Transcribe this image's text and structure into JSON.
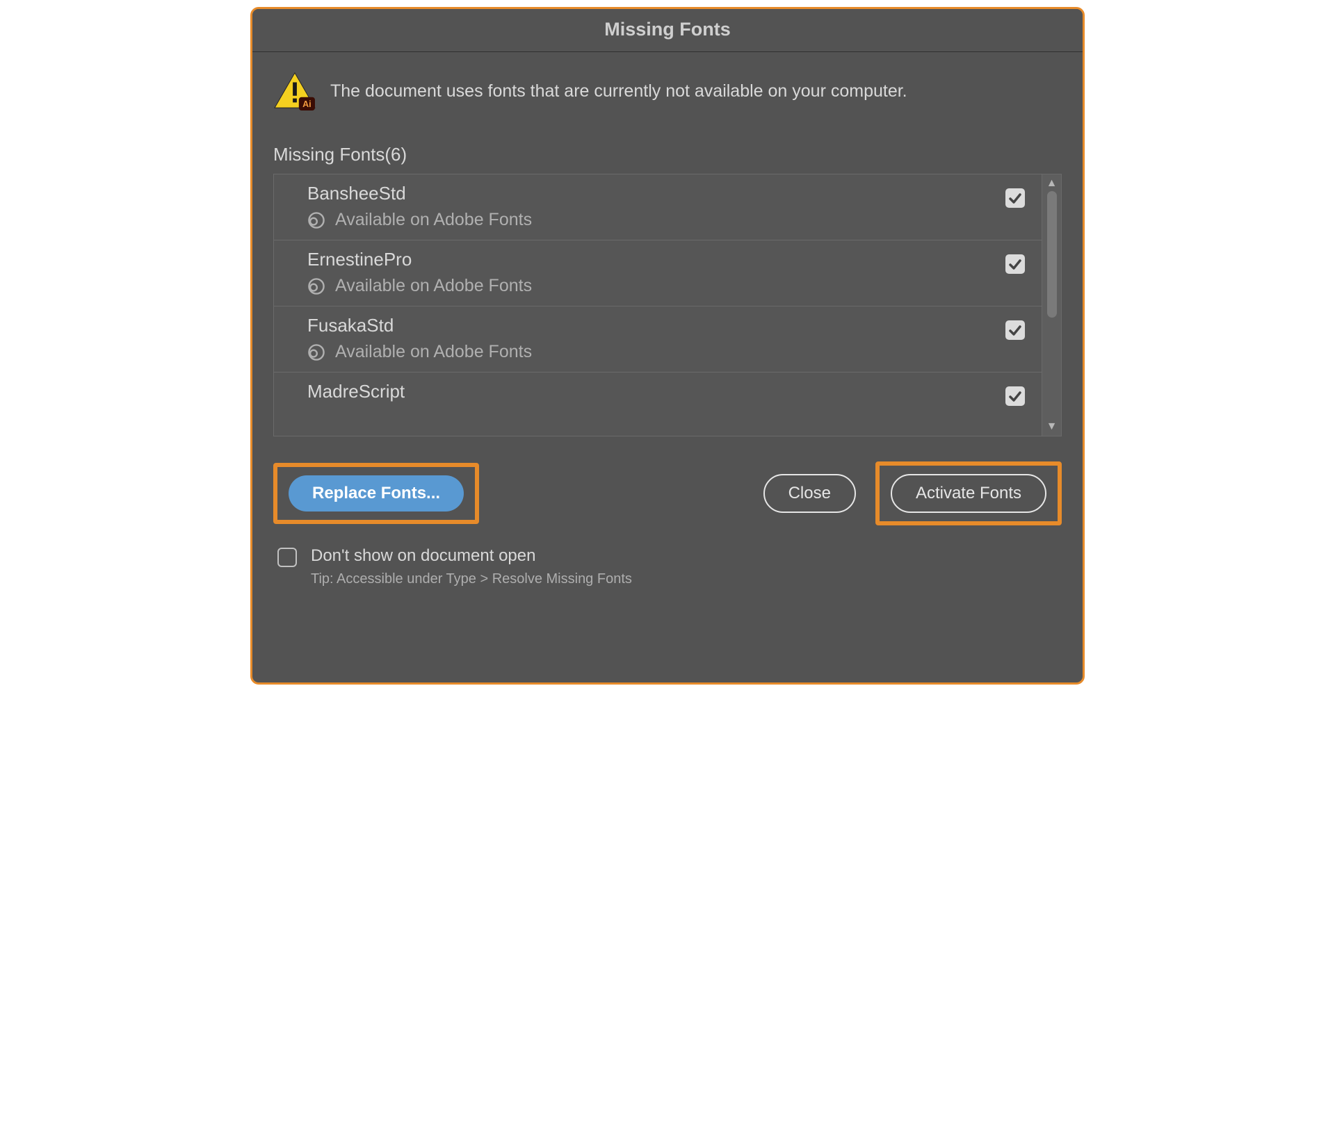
{
  "dialog": {
    "title": "Missing Fonts",
    "message": "The document uses fonts that are currently not available on your computer.",
    "list_label": "Missing Fonts(6)",
    "fonts": [
      {
        "name": "BansheeStd",
        "availability": "Available on Adobe Fonts",
        "checked": true
      },
      {
        "name": "ErnestinePro",
        "availability": "Available on Adobe Fonts",
        "checked": true
      },
      {
        "name": "FusakaStd",
        "availability": "Available on Adobe Fonts",
        "checked": true
      },
      {
        "name": "MadreScript",
        "availability": "",
        "checked": true
      }
    ],
    "buttons": {
      "replace": "Replace Fonts...",
      "close": "Close",
      "activate": "Activate Fonts"
    },
    "footer": {
      "checkbox_label": "Don't show on document open",
      "tip": "Tip: Accessible under Type > Resolve Missing Fonts"
    },
    "icons": {
      "warning": "warning-icon",
      "cc": "creative-cloud-icon",
      "check": "checkmark-icon"
    }
  }
}
